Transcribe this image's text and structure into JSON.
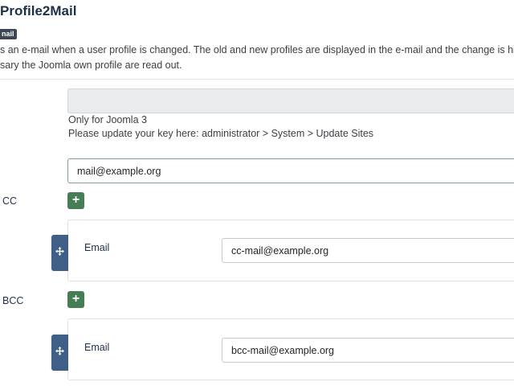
{
  "header": {
    "title": "Profile2Mail",
    "badge": "nail",
    "description_line1": "s an e-mail when a user profile is changed. The old and new profiles are displayed in the e-mail and the change is highlighted. Th",
    "description_line2": "sary the Joomla own profile are read out."
  },
  "key_field": {
    "value": "",
    "hint_line1": "Only for Joomla 3",
    "hint_line2": "Please update your key here: administrator > System > Update Sites"
  },
  "mail_field": {
    "value": "mail@example.org"
  },
  "cc": {
    "label": "CC",
    "add_icon": "plus-icon",
    "handle_icon": "move-icon",
    "email_label": "Email",
    "email_value": "cc-mail@example.org"
  },
  "bcc": {
    "label": "BCC",
    "add_icon": "plus-icon",
    "handle_icon": "move-icon",
    "email_label": "Email",
    "email_value": "bcc-mail@example.org"
  },
  "colors": {
    "title": "#1e3049",
    "add_button": "#457d54",
    "drag_handle": "#3f5f86",
    "badge": "#3b4753"
  }
}
